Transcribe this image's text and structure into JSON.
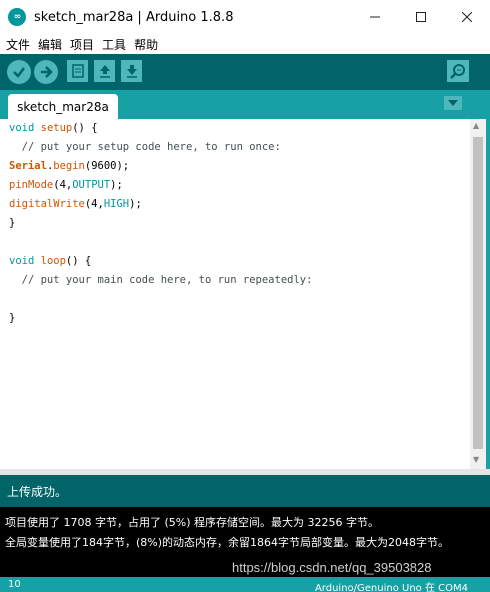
{
  "window": {
    "title": "sketch_mar28a | Arduino 1.8.8",
    "logo_text": "∞"
  },
  "menu": {
    "items": [
      "文件",
      "编辑",
      "项目",
      "工具",
      "帮助"
    ]
  },
  "toolbar": {
    "buttons": [
      "verify-icon",
      "upload-icon",
      "new-icon",
      "open-icon",
      "save-icon",
      "serial-monitor-icon"
    ]
  },
  "tabs": [
    {
      "label": "sketch_mar28a",
      "active": true
    }
  ],
  "editor": {
    "lines": [
      "void setup() {",
      "  // put your setup code here, to run once:",
      "Serial.begin(9600);",
      "pinMode(4,OUTPUT);",
      "digitalWrite(4,HIGH);",
      "}",
      "",
      "void loop() {",
      "  // put your main code here, to run repeatedly:",
      "",
      "}"
    ]
  },
  "status": {
    "message": "上传成功。"
  },
  "console": {
    "lines": [
      "项目使用了 1708 字节，占用了 (5%) 程序存储空间。最大为 32256 字节。",
      "全局变量使用了184字节，(8%)的动态内存，余留1864字节局部变量。最大为2048字节。"
    ]
  },
  "watermark": "https://blog.csdn.net/qq_39503828",
  "footer": {
    "line_number": "10",
    "board": "Arduino/Genuino Uno 在 COM4"
  },
  "colors": {
    "toolbar": "#006468",
    "tabbar": "#17a1a5",
    "button": "#4db7bb",
    "console_bg": "#000000"
  }
}
